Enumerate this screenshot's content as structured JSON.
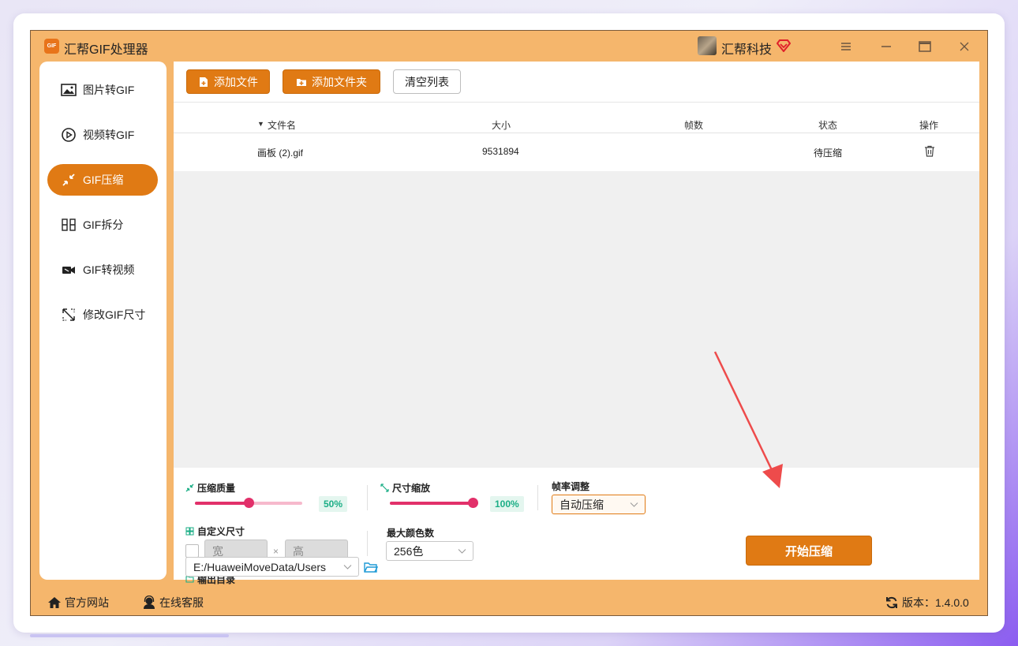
{
  "window": {
    "logo_text": "GIF",
    "title": "汇帮GIF处理器",
    "company": "汇帮科技",
    "buttons": [
      "menu",
      "minimize",
      "maximize",
      "close"
    ]
  },
  "sidebar": {
    "items": [
      {
        "label": "图片转GIF",
        "icon": "image-icon",
        "active": false
      },
      {
        "label": "视频转GIF",
        "icon": "play-circle-icon",
        "active": false
      },
      {
        "label": "GIF压缩",
        "icon": "compress-icon",
        "active": true
      },
      {
        "label": "GIF拆分",
        "icon": "split-icon",
        "active": false
      },
      {
        "label": "GIF转视频",
        "icon": "video-camera-icon",
        "active": false
      },
      {
        "label": "修改GIF尺寸",
        "icon": "resize-icon",
        "active": false
      }
    ]
  },
  "toolbar": {
    "add_file": "添加文件",
    "add_folder": "添加文件夹",
    "clear_list": "清空列表"
  },
  "table": {
    "columns": [
      "文件名",
      "大小",
      "帧数",
      "状态",
      "操作"
    ],
    "rows": [
      {
        "name": "画板 (2).gif",
        "size": "9531894",
        "frames": "",
        "status": "待压缩"
      }
    ]
  },
  "settings": {
    "quality_label": "压缩质量",
    "quality_value": 0.5,
    "quality_text": "50%",
    "scale_label": "尺寸缩放",
    "scale_value": 1.0,
    "scale_text": "100%",
    "framerate_label": "帧率调整",
    "framerate_value": "自动压缩",
    "custom_size_label": "自定义尺寸",
    "width_placeholder": "宽",
    "height_placeholder": "高",
    "times_sign": "×",
    "max_colors_label": "最大颜色数",
    "max_colors_value": "256色",
    "output_label": "输出目录",
    "output_path": "E:/HuaweiMoveData/Users",
    "start_button": "开始压缩"
  },
  "footer": {
    "website": "官方网站",
    "support": "在线客服",
    "version": "版本：1.4.0.0"
  },
  "colors": {
    "accent": "#e07a14",
    "frame": "#f5b66c",
    "slider": "#e2306a",
    "badge_text": "#1bae86",
    "annotation_arrow": "#ee4b4b"
  }
}
